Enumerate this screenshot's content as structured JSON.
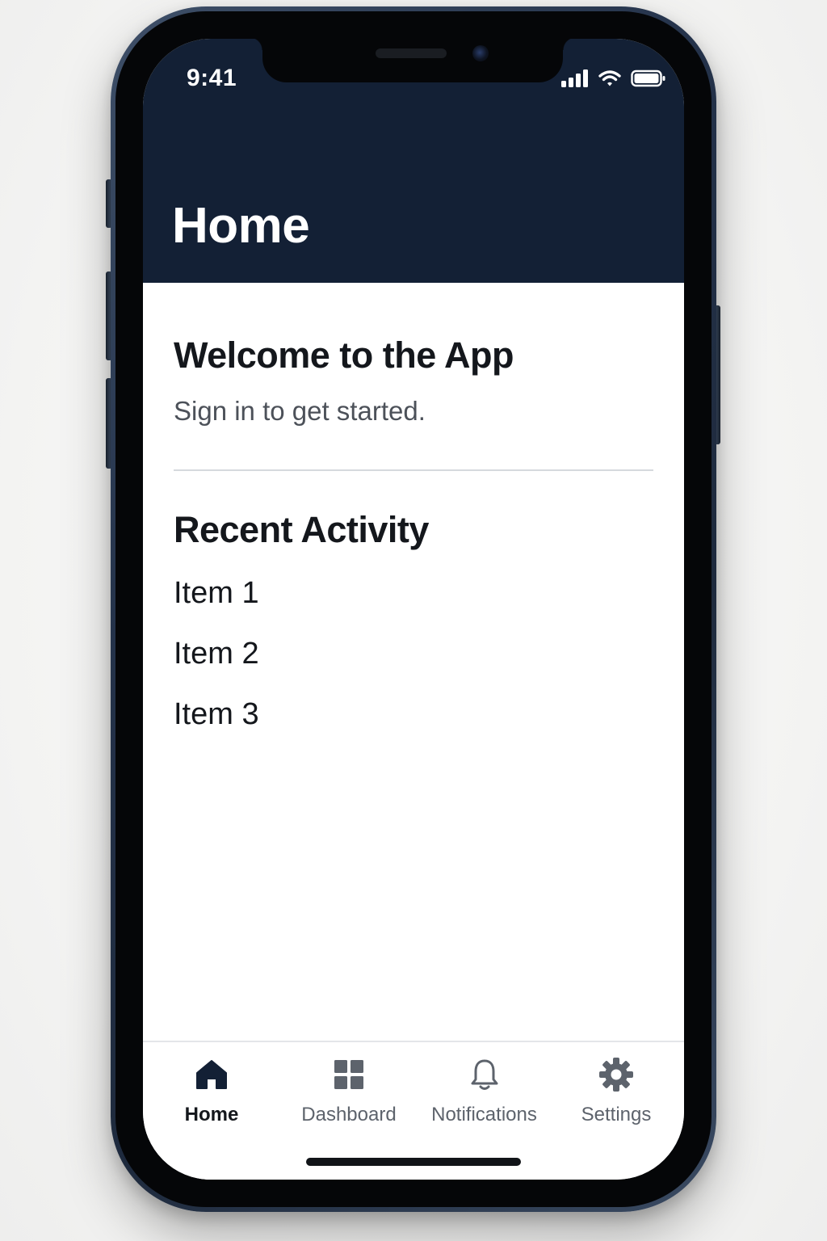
{
  "status_bar": {
    "time": "9:41",
    "icons": [
      "signal-icon",
      "wifi-icon",
      "battery-icon"
    ]
  },
  "header": {
    "title": "Home",
    "background_color": "#132035"
  },
  "welcome": {
    "title": "Welcome to the App",
    "subtitle": "Sign in to get started."
  },
  "recent_activity": {
    "title": "Recent Activity",
    "items": [
      "Item 1",
      "Item 2",
      "Item 3"
    ]
  },
  "tabbar": {
    "active_tab": "Home",
    "tabs": [
      {
        "label": "Home",
        "icon": "home-icon"
      },
      {
        "label": "Dashboard",
        "icon": "dashboard-grid-icon"
      },
      {
        "label": "Notifications",
        "icon": "bell-icon"
      },
      {
        "label": "Settings",
        "icon": "gear-icon"
      }
    ]
  },
  "colors": {
    "accent": "#132035",
    "text_primary": "#14171c",
    "text_secondary": "#4c5159",
    "tab_inactive": "#5d636c"
  }
}
